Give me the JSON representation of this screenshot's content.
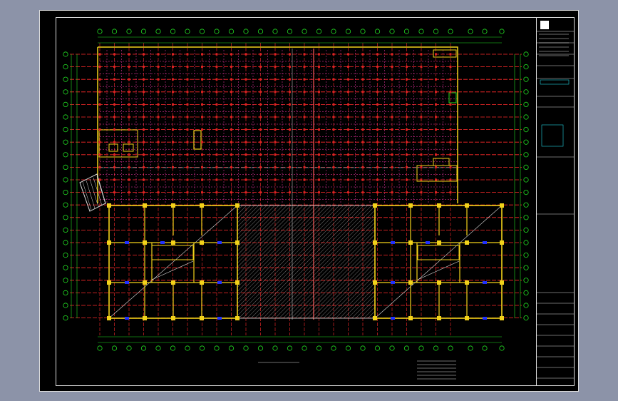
{
  "drawing": {
    "caption": "",
    "scale_text": ""
  },
  "colors": {
    "background": "#8c93a8",
    "paper": "#000000",
    "grid_red": "#ff2b2b",
    "grid_magenta": "#ff3bb0",
    "axis_green": "#22dd22",
    "wall_yellow": "#f2d21a",
    "column_blue": "#2030ff",
    "dim_white": "#dcdcdc",
    "hatch_white": "#bfbfbf",
    "accent_cyan": "#21d3e0"
  },
  "icons": {
    "sheet_logo": "square-logo-icon"
  }
}
